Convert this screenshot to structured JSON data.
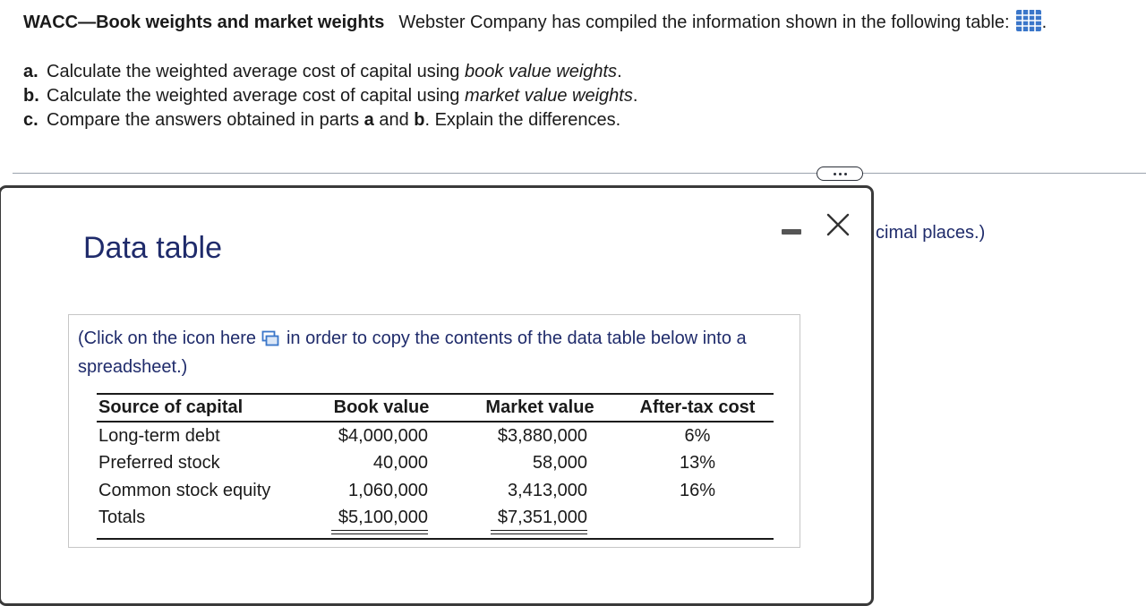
{
  "question": {
    "title": "WACC—Book weights and market weights",
    "intro": "Webster Company has compiled the information shown in the following table:",
    "trailing": ".",
    "parts": [
      {
        "letter": "a.",
        "before": "Calculate the weighted average cost of capital using ",
        "emph": "book value weights",
        "after": "."
      },
      {
        "letter": "b.",
        "before": "Calculate the weighted average cost of capital using ",
        "emph": "market value weights",
        "after": "."
      },
      {
        "letter": "c.",
        "before": "Compare the answers obtained in parts ",
        "bold1": "a",
        "mid": " and ",
        "bold2": "b",
        "after": ". Explain the differences."
      }
    ],
    "behind_text": "cimal places.)"
  },
  "modal": {
    "title": "Data table",
    "copy_note_before": "(Click on the icon  here",
    "copy_note_after": "in order to copy the contents of the data table below into a spreadsheet.)",
    "table": {
      "headers": [
        "Source of capital",
        "Book value",
        "Market value",
        "After-tax cost"
      ],
      "rows": [
        [
          "Long-term debt",
          "$4,000,000",
          "$3,880,000",
          "6%"
        ],
        [
          "Preferred stock",
          "40,000",
          "58,000",
          "13%"
        ],
        [
          "Common stock equity",
          "1,060,000",
          "3,413,000",
          "16%"
        ],
        [
          "Totals",
          "$5,100,000",
          "$7,351,000",
          ""
        ]
      ]
    }
  },
  "icons": {
    "table_icon": "table-grid-icon",
    "copy_icon": "copy-icon",
    "more_icon": "ellipsis-icon",
    "minimize_icon": "minimize-icon",
    "close_icon": "close-icon"
  },
  "colors": {
    "link_blue": "#1f2b6b",
    "icon_blue": "#3a76c9"
  }
}
